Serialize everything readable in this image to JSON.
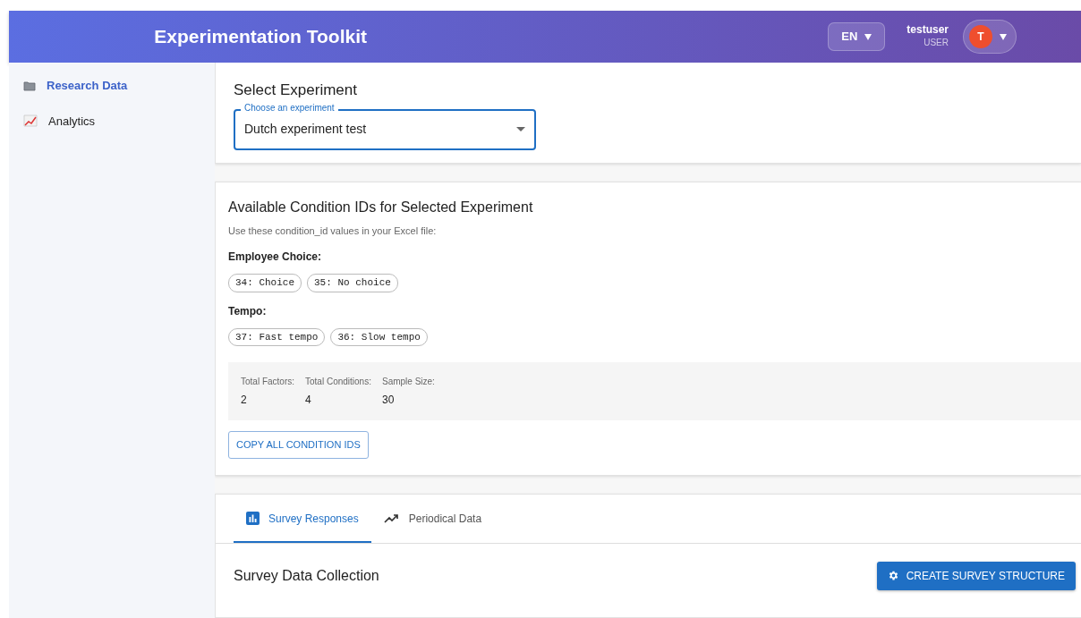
{
  "header": {
    "title": "Experimentation Toolkit",
    "language": "EN",
    "user": {
      "name": "testuser",
      "role": "USER",
      "initial": "T"
    }
  },
  "sidebar": {
    "items": [
      {
        "label": "Research Data",
        "kind": "folder",
        "selected": true
      },
      {
        "label": "Analytics",
        "kind": "chart",
        "selected": false
      }
    ]
  },
  "select_experiment": {
    "title": "Select Experiment",
    "field_label": "Choose an experiment",
    "value": "Dutch experiment test"
  },
  "conditions": {
    "title": "Available Condition IDs for Selected Experiment",
    "hint": "Use these condition_id values in your Excel file:",
    "factors": [
      {
        "name": "Employee Choice:",
        "chips": [
          "34: Choice",
          "35: No choice"
        ]
      },
      {
        "name": "Tempo:",
        "chips": [
          "37: Fast tempo",
          "36: Slow tempo"
        ]
      }
    ],
    "stats": [
      {
        "label": "Total Factors:",
        "value": "2"
      },
      {
        "label": "Total Conditions:",
        "value": "4"
      },
      {
        "label": "Sample Size:",
        "value": "30"
      }
    ],
    "copy_button": "COPY ALL CONDITION IDS"
  },
  "tabs": [
    {
      "label": "Survey Responses",
      "kind": "bars",
      "selected": true
    },
    {
      "label": "Periodical Data",
      "kind": "trend",
      "selected": false
    }
  ],
  "survey": {
    "title": "Survey Data Collection",
    "button": "CREATE SURVEY STRUCTURE"
  }
}
